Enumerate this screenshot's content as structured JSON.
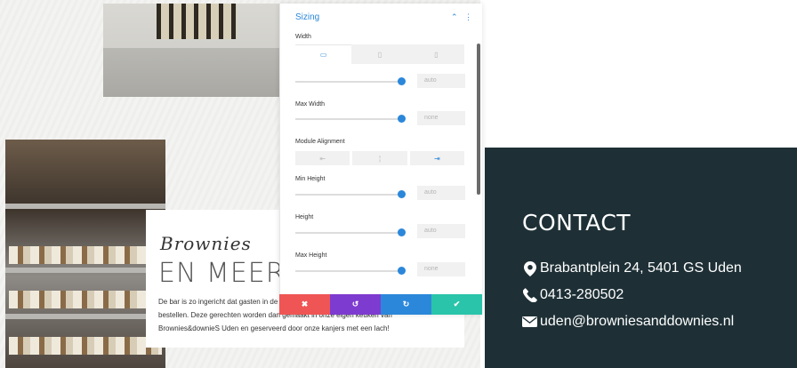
{
  "site": {
    "heading_script": "Brownies",
    "heading_big": "EN MEER",
    "paragraph_lines": [
      "De bar is zo ingericht dat gasten in de",
      "bestellen. Deze gerechten worden dan gemaakt in onze eigen keuken van",
      "Brownies&downieS Uden en geserveerd door onze kanjers met een lach!"
    ]
  },
  "panel": {
    "title": "Sizing",
    "fields": {
      "width": {
        "label": "Width",
        "value": "auto"
      },
      "max_width": {
        "label": "Max Width",
        "value": "none"
      },
      "module_alignment": {
        "label": "Module Alignment"
      },
      "min_height": {
        "label": "Min Height",
        "value": "auto"
      },
      "height": {
        "label": "Height",
        "value": "auto"
      },
      "max_height": {
        "label": "Max Height",
        "value": "none"
      }
    },
    "actions": {
      "cancel_color": "#ef5555",
      "undo_color": "#7e3bd0",
      "redo_color": "#2b87da",
      "save_color": "#29c4a9"
    },
    "accent_color": "#2b87da"
  },
  "contact": {
    "title": "CONTACT",
    "address": "Brabantplein 24, 5401 GS Uden",
    "phone": "0413-280502",
    "email": "uden@browniesanddownies.nl",
    "background": "#1e3036",
    "icons": [
      "map-marker-icon",
      "phone-icon",
      "envelope-icon"
    ]
  }
}
